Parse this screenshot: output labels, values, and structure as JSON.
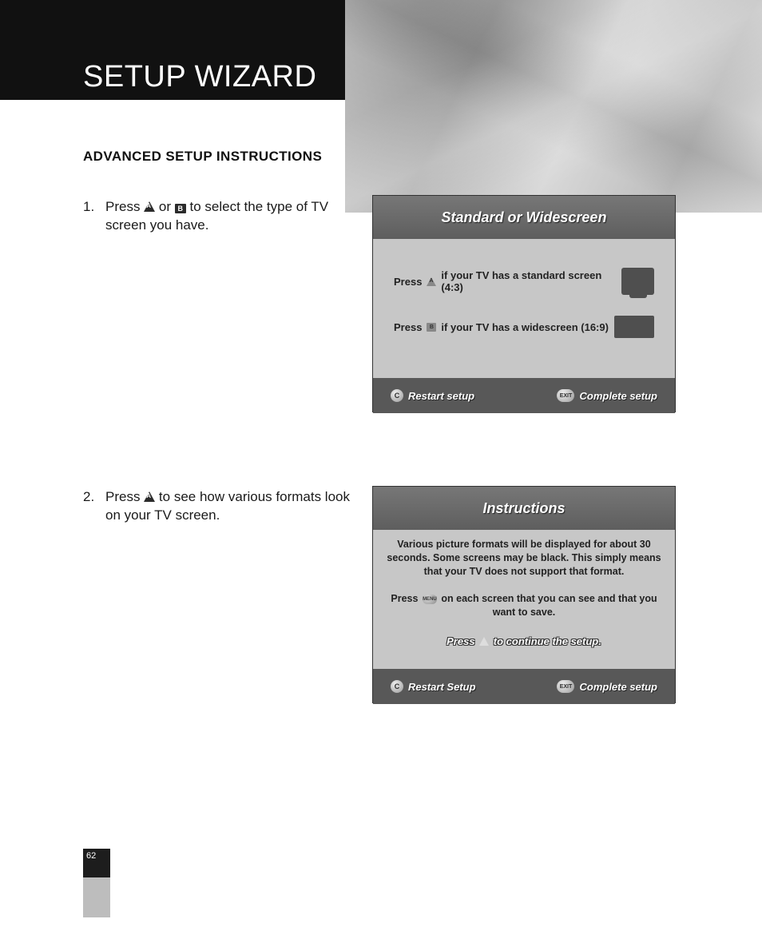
{
  "header": {
    "title": "SETUP WIZARD"
  },
  "section_heading": "ADVANCED SETUP INSTRUCTIONS",
  "step1": {
    "num": "1.",
    "pre": "Press ",
    "mid": " or ",
    "post": " to select the type of TV screen you have."
  },
  "step2": {
    "num": "2.",
    "pre": "Press ",
    "post": " to see how various formats look on your TV screen."
  },
  "shot1": {
    "title": "Standard or Widescreen",
    "row43_pre": "Press ",
    "row43_post": " if your TV has a standard screen (4:3)",
    "row169_pre": "Press ",
    "row169_post": " if your TV has a widescreen (16:9)",
    "footer_left_label": "Restart setup",
    "footer_left_icon": "C",
    "footer_right_label": "Complete setup",
    "footer_right_icon": "EXIT"
  },
  "shot2": {
    "title": "Instructions",
    "para1": "Various picture formats will be displayed for about 30 seconds. Some screens may be black. This simply means that your TV does not support that format.",
    "para2_pre": "Press ",
    "para2_post": " on each screen that you can see and that you want to save.",
    "para2_icon": "MENU",
    "para3_pre": "Press ",
    "para3_post": " to continue the setup.",
    "footer_left_label": "Restart Setup",
    "footer_left_icon": "C",
    "footer_right_label": "Complete setup",
    "footer_right_icon": "EXIT"
  },
  "page_number": "62"
}
